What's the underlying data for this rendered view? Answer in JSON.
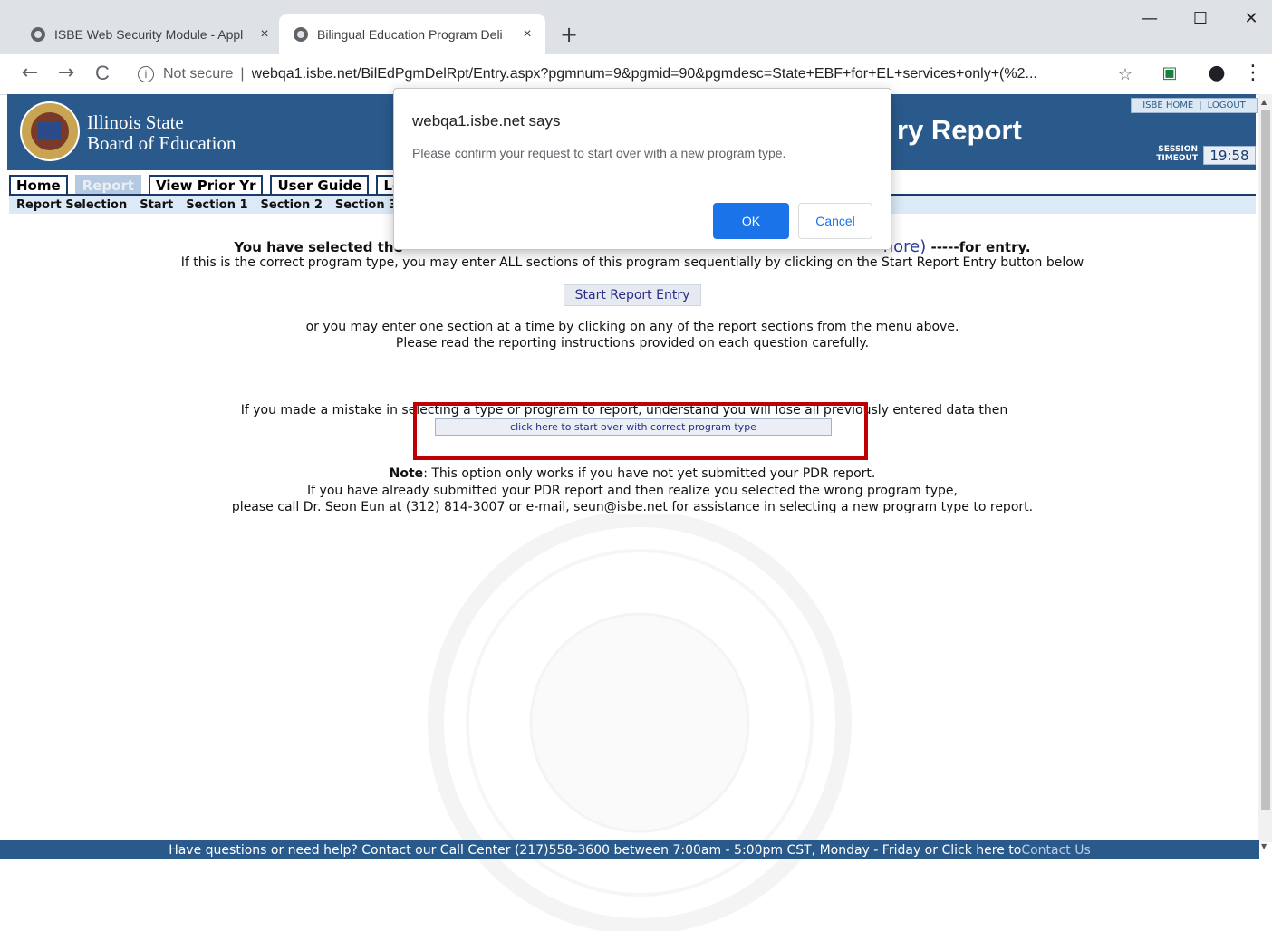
{
  "browser": {
    "tabs": [
      {
        "title": "ISBE Web Security Module - Appl",
        "close": "×"
      },
      {
        "title": "Bilingual Education Program Deli",
        "close": "×"
      }
    ],
    "new_tab": "+",
    "window": {
      "minimize": "—",
      "maximize": "☐",
      "close": "✕"
    },
    "nav": {
      "back": "←",
      "forward": "→",
      "reload": "C"
    },
    "omnibox": {
      "info": "i",
      "not_secure": "Not secure",
      "separator": "|",
      "url": "webqa1.isbe.net/BilEdPgmDelRpt/Entry.aspx?pgmnum=9&pgmid=90&pgmdesc=State+EBF+for+EL+services+only+(%2...",
      "star": "☆"
    },
    "extension": "▣",
    "profile": "●",
    "menu": "⋮"
  },
  "header": {
    "org_line1": "Illinois State",
    "org_line2": "Board of Education",
    "report_title": "ry Report",
    "links": {
      "home": "ISBE HOME",
      "sep": "|",
      "logout": "LOGOUT"
    },
    "session_label_1": "SESSION",
    "session_label_2": "TIMEOUT",
    "session_time": "19:58"
  },
  "nav": {
    "tabs": [
      "Home",
      "Report",
      "View Prior Yr",
      "User Guide",
      "Lo"
    ],
    "active_index": 1,
    "sub": [
      "Report Selection",
      "Start",
      "Section 1",
      "Section 2",
      "Section 3"
    ]
  },
  "content": {
    "selected_prefix": "You have selected the",
    "selected_more": "nore)",
    "selected_suffix": " -----for entry.",
    "line_correct": "If this is the correct program type, you may enter ALL sections of this program sequentially by clicking on the Start Report Entry button below",
    "start_button": "Start Report Entry",
    "line_sections_1": "or you may enter one section at a time by clicking on any of the report sections from the menu above.",
    "line_sections_2": "Please read the reporting instructions provided on each question carefully.",
    "line_mistake": "If you made a mistake in selecting a type or program to report, understand you will lose all previously entered data then",
    "startover_button": "click here to start over with correct program type",
    "note_label": "Note",
    "note_text": ": This option only works if you have not yet submitted your PDR report.",
    "line_submitted": "If you have already submitted your PDR report and then realize you selected the wrong program type,",
    "line_call": "please call Dr. Seon Eun at (312) 814-3007 or e-mail, seun@isbe.net for assistance in selecting a new program type to report."
  },
  "footer": {
    "text": "Have questions or need help? Contact our Call Center (217)558-3600 between 7:00am - 5:00pm CST, Monday - Friday or Click here to ",
    "link": "Contact Us"
  },
  "dialog": {
    "title": "webqa1.isbe.net says",
    "message": "Please confirm your request to start over with a new program type.",
    "ok": "OK",
    "cancel": "Cancel"
  },
  "scrollbar": {
    "up": "▲",
    "down": "▼"
  },
  "colors": {
    "header_blue": "#2a5a8c",
    "dialog_button": "#1a73e8",
    "highlight_red": "#c00000"
  }
}
